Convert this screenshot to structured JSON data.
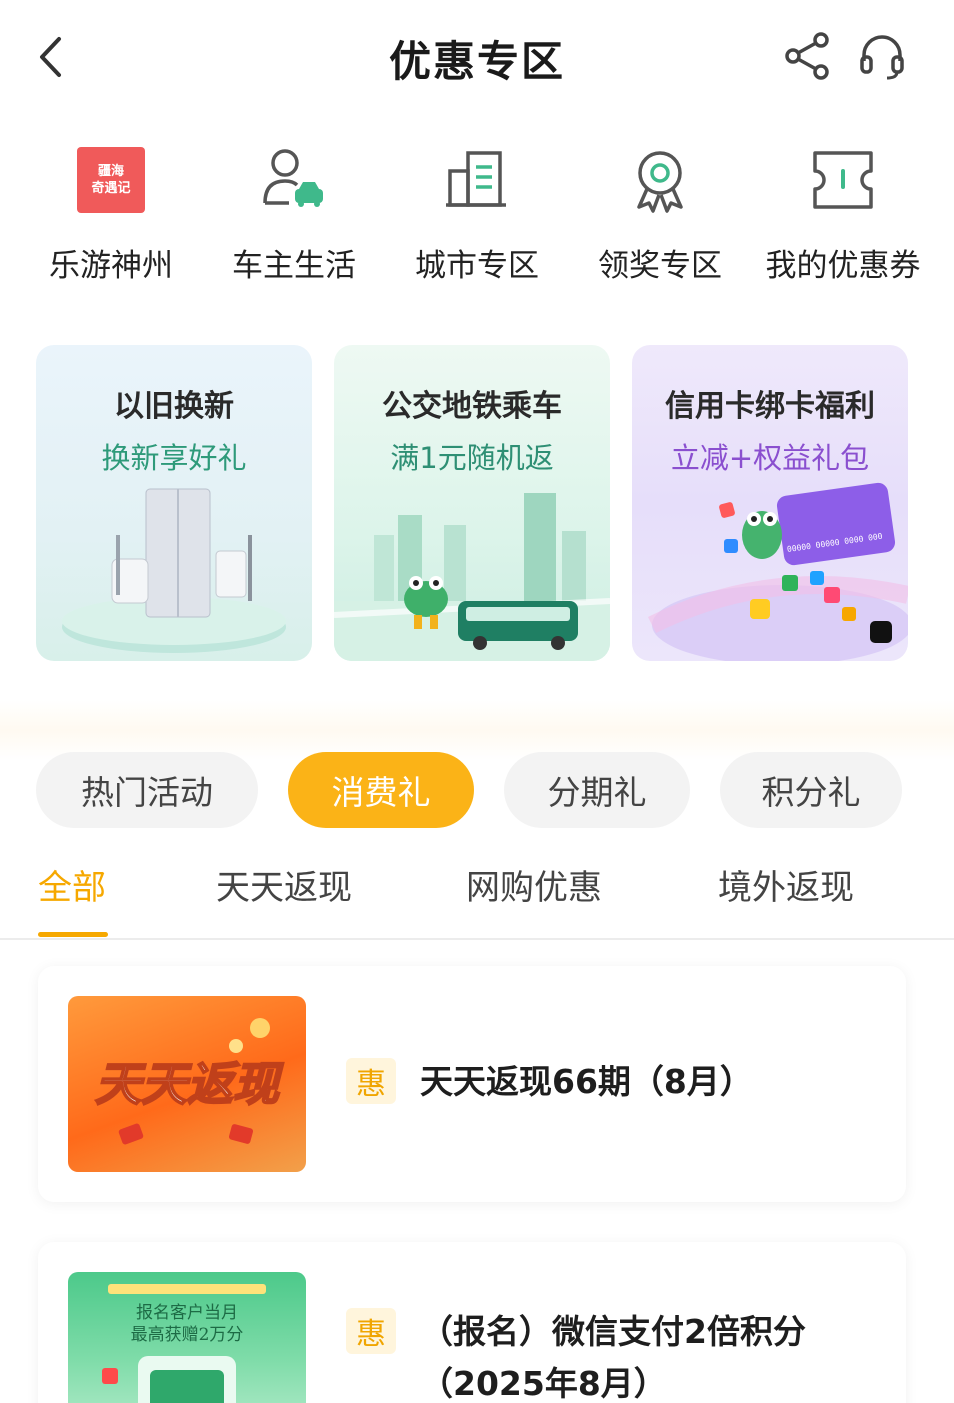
{
  "header": {
    "title": "优惠专区",
    "back_icon": "chevron-left-icon",
    "share_icon": "share-icon",
    "support_icon": "headset-icon"
  },
  "quick_nav": [
    {
      "label": "乐游神州",
      "icon": "travel-logo-icon",
      "logo_text_1": "疆海",
      "logo_text_2": "奇遇记"
    },
    {
      "label": "车主生活",
      "icon": "car-owner-icon"
    },
    {
      "label": "城市专区",
      "icon": "city-building-icon"
    },
    {
      "label": "领奖专区",
      "icon": "award-medal-icon"
    },
    {
      "label": "我的优惠券",
      "icon": "coupon-icon"
    }
  ],
  "banners": [
    {
      "title": "以旧换新",
      "subtitle": "换新享好礼"
    },
    {
      "title": "公交地铁乘车",
      "subtitle": "满1元随机返"
    },
    {
      "title": "信用卡绑卡福利",
      "subtitle": "立减+权益礼包",
      "card_number": "00000 00000 0000 000"
    }
  ],
  "pills": [
    {
      "label": "热门活动",
      "active": false
    },
    {
      "label": "消费礼",
      "active": true
    },
    {
      "label": "分期礼",
      "active": false
    },
    {
      "label": "积分礼",
      "active": false
    }
  ],
  "subtabs": [
    {
      "label": "全部",
      "active": true
    },
    {
      "label": "天天返现",
      "active": false
    },
    {
      "label": "网购优惠",
      "active": false
    },
    {
      "label": "境外返现",
      "active": false
    }
  ],
  "list": [
    {
      "badge": "惠",
      "title": "天天返现66期（8月）",
      "thumb_text": "天天返现"
    },
    {
      "badge": "惠",
      "title_line1": "（报名）微信支付2倍积分",
      "title_line2": "（2025年8月）",
      "thumb_line1": "报名客户当月",
      "thumb_line2": "最高获赠2万分"
    }
  ],
  "colors": {
    "accent": "#fbb317",
    "tab_active": "#f6a800",
    "green": "#2e9a7a",
    "purple": "#8a4fcf"
  }
}
